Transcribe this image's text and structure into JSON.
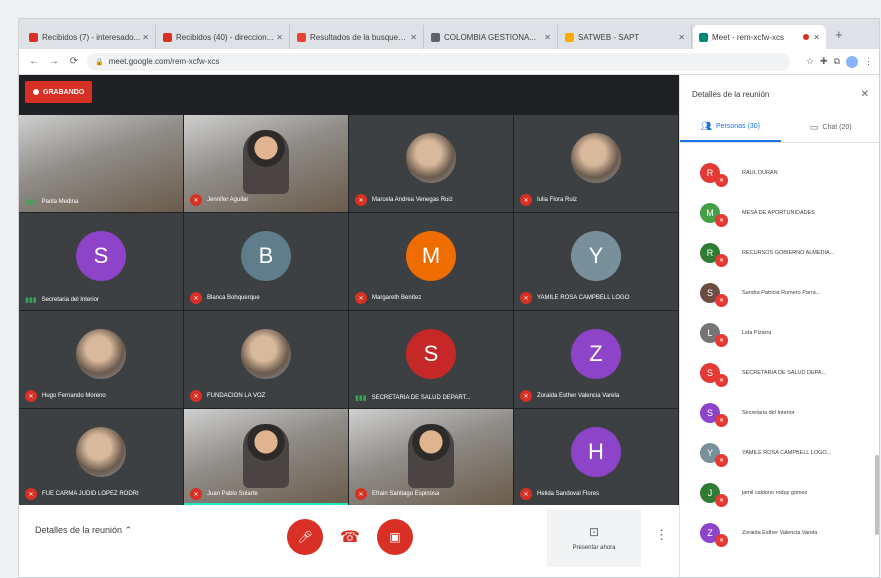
{
  "browser": {
    "tabs": [
      {
        "label": "Recibidos (7) - interesado...",
        "color": "#d93025"
      },
      {
        "label": "Recibidos (40) - direccion...",
        "color": "#d93025"
      },
      {
        "label": "Resultados de la busqueda...",
        "color": "#ea4335"
      },
      {
        "label": "COLOMBIA GESTIONA...",
        "color": "#5f6368"
      },
      {
        "label": "SATWEB - SAPT",
        "color": "#f9ab00"
      },
      {
        "label": "Meet - rem-xcfw-xcs",
        "color": "#00897b",
        "active": true
      }
    ],
    "url": "meet.google.com/rem-xcfw-xcs"
  },
  "stage": {
    "recording_label": "GRABANDO",
    "tiles": [
      {
        "kind": "video",
        "name": "Paola Medina",
        "mic": "bars"
      },
      {
        "kind": "video-person",
        "name": "Jennifer Aguilar",
        "mic": "muted"
      },
      {
        "kind": "photo",
        "name": "Marcela Andrea Venegas Ruiz",
        "mic": "muted"
      },
      {
        "kind": "photo",
        "name": "Iulia Flora Ruiz",
        "mic": "muted"
      },
      {
        "kind": "avatar",
        "letter": "S",
        "color": "#8e44c9",
        "name": "Secretaria del Interior",
        "mic": "bars"
      },
      {
        "kind": "avatar",
        "letter": "B",
        "color": "#607d8b",
        "name": "Blanca Bohquerque",
        "mic": "muted"
      },
      {
        "kind": "avatar",
        "letter": "M",
        "color": "#ef6c00",
        "name": "Margareth Benítez",
        "mic": "muted"
      },
      {
        "kind": "avatar",
        "letter": "Y",
        "color": "#78909c",
        "name": "YAMILE ROSA CAMPBELL LOGO",
        "mic": "muted"
      },
      {
        "kind": "photo",
        "name": "Hugo Fernando Moreno",
        "mic": "muted"
      },
      {
        "kind": "photo",
        "name": "FUNDACION LA VOZ",
        "mic": "muted"
      },
      {
        "kind": "avatar",
        "letter": "S",
        "color": "#c62828",
        "name": "SECRETARIA DE SALUD DEPART...",
        "mic": "bars"
      },
      {
        "kind": "avatar",
        "letter": "Z",
        "color": "#8e44c9",
        "name": "Zoraida Esther Valencia Varela",
        "mic": "muted"
      },
      {
        "kind": "photo",
        "name": "FUE CARMA JUDID LOPEZ RODRI",
        "mic": "muted"
      },
      {
        "kind": "video-person",
        "name": "Juan Pablo Solarte",
        "mic": "muted",
        "speaking": true
      },
      {
        "kind": "video-person",
        "name": "Efrain Santiago Espinosa",
        "mic": "muted"
      },
      {
        "kind": "avatar",
        "letter": "H",
        "color": "#8e44c9",
        "name": "Helida Sandoval Flores",
        "mic": "muted"
      }
    ]
  },
  "controls": {
    "meeting_details": "Detalles de la reunión",
    "present_label": "Presentar ahora",
    "mic_icon": "mic-off-icon",
    "hang_icon": "hang-up-icon",
    "cam_icon": "camera-off-icon"
  },
  "panel": {
    "title": "Detalles de la reunión",
    "tab_people": "Personas (30)",
    "tab_chat": "Chat (20)",
    "people": [
      {
        "letter": "R",
        "color": "#e53935",
        "name": "RAUL DURAN"
      },
      {
        "letter": "M",
        "color": "#43a047",
        "name": "MESA DE APORTUNIDADES"
      },
      {
        "letter": "R",
        "color": "#2e7d32",
        "name": "RECURSOS GOBIERNO ALMEDIA..."
      },
      {
        "letter": "S",
        "color": "#6d4c41",
        "name": "Sandra Patricia Romero Parra..."
      },
      {
        "letter": "L",
        "color": "#757575",
        "name": "Lida Pizarra"
      },
      {
        "letter": "S",
        "color": "#e53935",
        "name": "SECRETARIA DE SALUD DEPA..."
      },
      {
        "letter": "S",
        "color": "#8e44c9",
        "name": "Secretaria del Interior"
      },
      {
        "letter": "Y",
        "color": "#78909c",
        "name": "YAMILE ROSA CAMPBELL LOGO..."
      },
      {
        "letter": "J",
        "color": "#2e7d32",
        "name": "jamil caldono roduy gomez"
      },
      {
        "letter": "Z",
        "color": "#8e44c9",
        "name": "Zoraida Esther Valencia Varela"
      }
    ]
  }
}
